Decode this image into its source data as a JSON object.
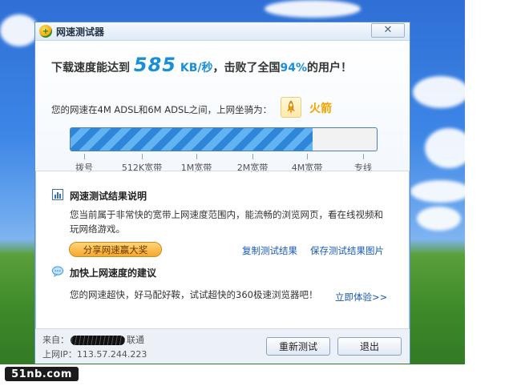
{
  "window": {
    "title": "网速测试器",
    "close_glyph": "✕"
  },
  "result": {
    "prefix": "下载速度能达到",
    "speed": "585",
    "unit": "KB/秒",
    "mid": "，击败了全国",
    "percent": "94%",
    "suffix": "的用户！",
    "progress_fraction": 0.79,
    "range_text": "您的网速在4M ADSL和6M ADSL之间，上网坐骑为：",
    "vehicle": "火箭"
  },
  "scale": {
    "labels": [
      "拨号",
      "512K宽带",
      "1M宽带",
      "2M宽带",
      "4M宽带",
      "专线"
    ]
  },
  "explain": {
    "title": "网速测试结果说明",
    "body": "您当前属于非常快的宽带上网速度范围内，能流畅的浏览网页，看在线视频和玩网络游戏。",
    "share_button": "分享网速赢大奖",
    "copy_link": "复制测试结果",
    "save_link": "保存测试结果图片"
  },
  "advice": {
    "title": "加快上网速度的建议",
    "body": "您的网速超快，好马配好鞍，试试超快的360极速浏览器吧！",
    "try_link": "立即体验>>"
  },
  "footer": {
    "from_label": "来自：",
    "isp": "联通",
    "ip_label": "上网IP：",
    "ip": "113.57.244.223",
    "retest_button": "重新测试",
    "exit_button": "退出"
  },
  "watermark": "51nb.com",
  "colors": {
    "accent_blue": "#1b8fd6",
    "rocket_gold": "#f2a400",
    "link_blue": "#1659b5"
  }
}
